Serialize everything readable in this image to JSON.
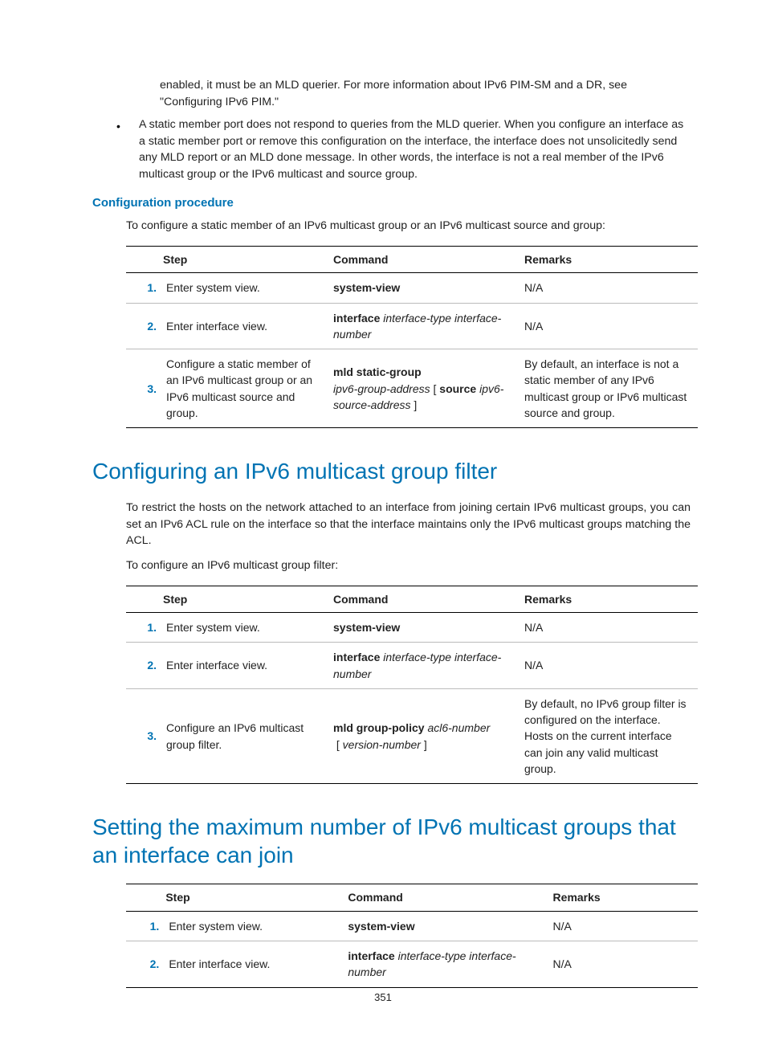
{
  "intro_para": "enabled, it must be an MLD querier. For more information about IPv6 PIM-SM and a DR, see \"Configuring IPv6 PIM.\"",
  "bullet2": "A static member port does not respond to queries from the MLD querier. When you configure an interface as a static member port or remove this configuration on the interface, the interface does not unsolicitedly send any MLD report or an MLD done message. In other words, the interface is not a real member of the IPv6 multicast group or the IPv6 multicast and source group.",
  "h4_config_procedure": "Configuration procedure",
  "para_config_static": "To configure a static member of an IPv6 multicast group or an IPv6 multicast source and group:",
  "columns": {
    "step": "Step",
    "command": "Command",
    "remarks": "Remarks"
  },
  "t1": {
    "r1": {
      "n": "1.",
      "step": "Enter system view.",
      "cmd_b": "system-view",
      "rem": "N/A"
    },
    "r2": {
      "n": "2.",
      "step": "Enter interface view.",
      "cmd_b": "interface",
      "cmd_i1": "interface-type interface-number",
      "rem": "N/A"
    },
    "r3": {
      "n": "3.",
      "step": "Configure a static member of an IPv6 multicast group or an IPv6 multicast source and group.",
      "cmd_b1": "mld static-group",
      "cmd_i1": "ipv6-group-address",
      "cmd_open": " [ ",
      "cmd_b2": "source",
      "cmd_i2": "ipv6-source-address",
      "cmd_close": " ]",
      "rem": "By default, an interface is not a static member of any IPv6 multicast group or IPv6 multicast source and group."
    }
  },
  "h2_group_filter": "Configuring an IPv6 multicast group filter",
  "para_filter_desc": "To restrict the hosts on the network attached to an interface from joining certain IPv6 multicast groups, you can set an IPv6 ACL rule on the interface so that the interface maintains only the IPv6 multicast groups matching the ACL.",
  "para_filter_lead": "To configure an IPv6 multicast group filter:",
  "t2": {
    "r1": {
      "n": "1.",
      "step": "Enter system view.",
      "cmd_b": "system-view",
      "rem": "N/A"
    },
    "r2": {
      "n": "2.",
      "step": "Enter interface view.",
      "cmd_b": "interface",
      "cmd_i1": "interface-type interface-number",
      "rem": "N/A"
    },
    "r3": {
      "n": "3.",
      "step": "Configure an IPv6 multicast group filter.",
      "cmd_b1": "mld group-policy",
      "cmd_i1": "acl6-number",
      "cmd_open": " [ ",
      "cmd_i2": "version-number",
      "cmd_close": " ]",
      "rem": "By default, no IPv6 group filter is configured on the interface. Hosts on the current interface can join any valid multicast group."
    }
  },
  "h2_max_groups": "Setting the maximum number of IPv6 multicast groups that an interface can join",
  "t3": {
    "r1": {
      "n": "1.",
      "step": "Enter system view.",
      "cmd_b": "system-view",
      "rem": "N/A"
    },
    "r2": {
      "n": "2.",
      "step": "Enter interface view.",
      "cmd_b": "interface",
      "cmd_i1": "interface-type interface-number",
      "rem": "N/A"
    }
  },
  "page_number": "351"
}
